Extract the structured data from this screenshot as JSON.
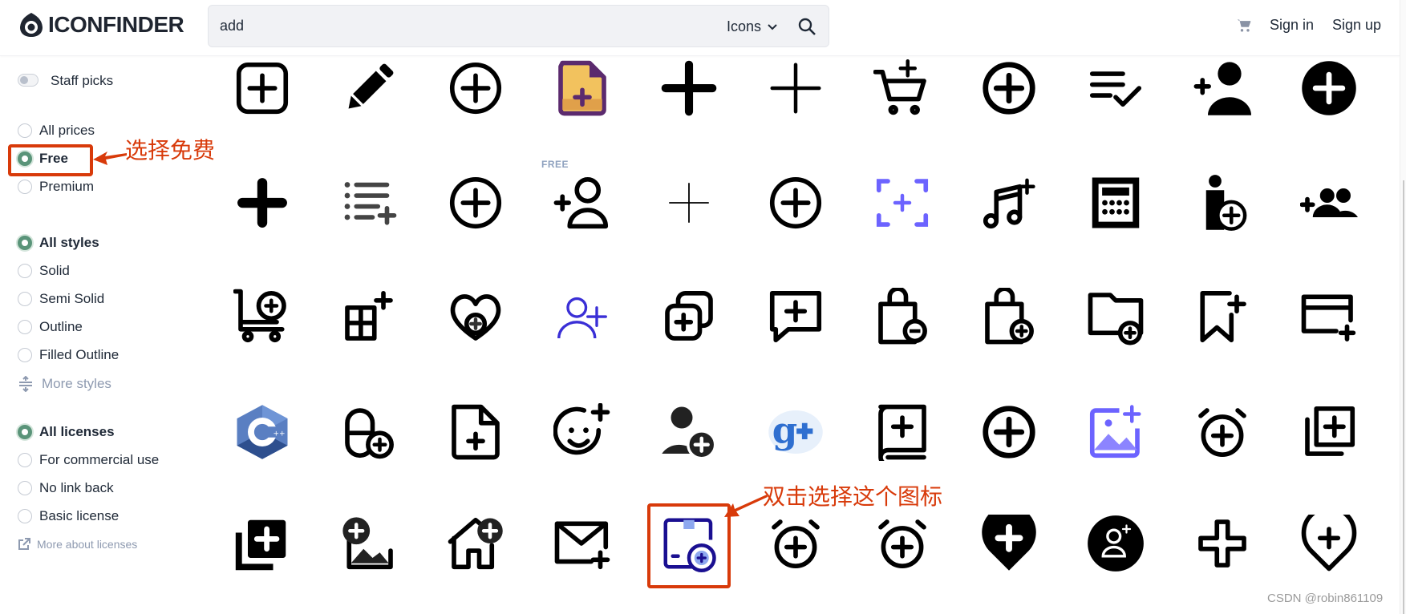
{
  "header": {
    "logo_text": "ICONFINDER",
    "search_value": "add",
    "search_type": "Icons",
    "sign_in": "Sign in",
    "sign_up": "Sign up"
  },
  "sidebar": {
    "staff_picks": {
      "label": "Staff picks",
      "on": false
    },
    "prices": [
      {
        "label": "All prices",
        "selected": false
      },
      {
        "label": "Free",
        "selected": true
      },
      {
        "label": "Premium",
        "selected": false
      }
    ],
    "styles": [
      {
        "label": "All styles",
        "selected": true
      },
      {
        "label": "Solid",
        "selected": false
      },
      {
        "label": "Semi Solid",
        "selected": false
      },
      {
        "label": "Outline",
        "selected": false
      },
      {
        "label": "Filled Outline",
        "selected": false
      }
    ],
    "more_styles": "More styles",
    "licenses": [
      {
        "label": "All licenses",
        "selected": true
      },
      {
        "label": "For commercial use",
        "selected": false
      },
      {
        "label": "No link back",
        "selected": false
      },
      {
        "label": "Basic license",
        "selected": false
      }
    ],
    "more_licenses": "More about licenses"
  },
  "results": {
    "free_badge": "FREE",
    "rows": [
      [
        "square-plus",
        "pencil",
        "circle-plus",
        "file-plus-color",
        "plus-bold",
        "plus-thin",
        "cart-plus",
        "circle-plus-thick",
        "list-check",
        "user-plus-solid",
        "circle-plus-solid"
      ],
      [
        "plus-rounded",
        "list-plus",
        "circle-plus",
        "user-plus-outline",
        "plus-hairline",
        "circle-plus",
        "scan-plus",
        "music-plus",
        "calculator",
        "person-plus-circle",
        "group-plus"
      ],
      [
        "cart-circle-plus",
        "grid-plus",
        "heart-plus",
        "user-plus-blue",
        "copy-plus",
        "chat-plus",
        "bag-minus",
        "bag-plus",
        "folder-plus",
        "bookmark-plus",
        "card-plus"
      ],
      [
        "cpp-logo",
        "pill-plus",
        "file-plus-outline",
        "smile-plus",
        "user-circle-plus",
        "google-plus",
        "book-plus",
        "circle-plus-thick",
        "image-plus-purple",
        "alarm-plus",
        "stack-plus-outline"
      ],
      [
        "stack-plus-solid",
        "image-plus-circle",
        "home-plus",
        "mail-plus",
        "box-plus",
        "alarm-plus",
        "alarm-plus",
        "pin-plus-solid",
        "user-circle-solid",
        "cross-outline",
        "pin-plus-outline"
      ]
    ]
  },
  "annotations": {
    "free_note": "选择免费",
    "icon_note": "双击选择这个图标"
  },
  "watermark": "CSDN @robin861109",
  "colors": {
    "accent_green": "#5a9479",
    "annotation_red": "#d83a0a",
    "purple": "#6c63ff",
    "navy": "#1a0f91"
  }
}
